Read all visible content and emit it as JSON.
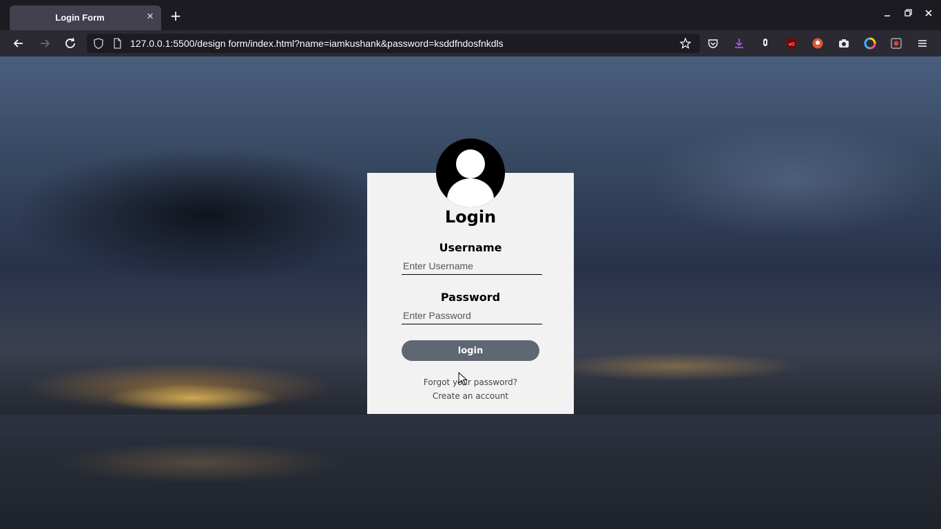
{
  "browser": {
    "tab_title": "Login Form",
    "tab_close": "✕",
    "new_tab": "+",
    "url": "127.0.0.1:5500/design form/index.html?name=iamkushank&password=ksddfndosfnkdls"
  },
  "page": {
    "title": "Login",
    "username_label": "Username",
    "username_placeholder": "Enter Username",
    "password_label": "Password",
    "password_placeholder": "Enter Password",
    "login_button": "login",
    "forgot_link": "Forgot your password?",
    "create_link": "Create an account"
  }
}
